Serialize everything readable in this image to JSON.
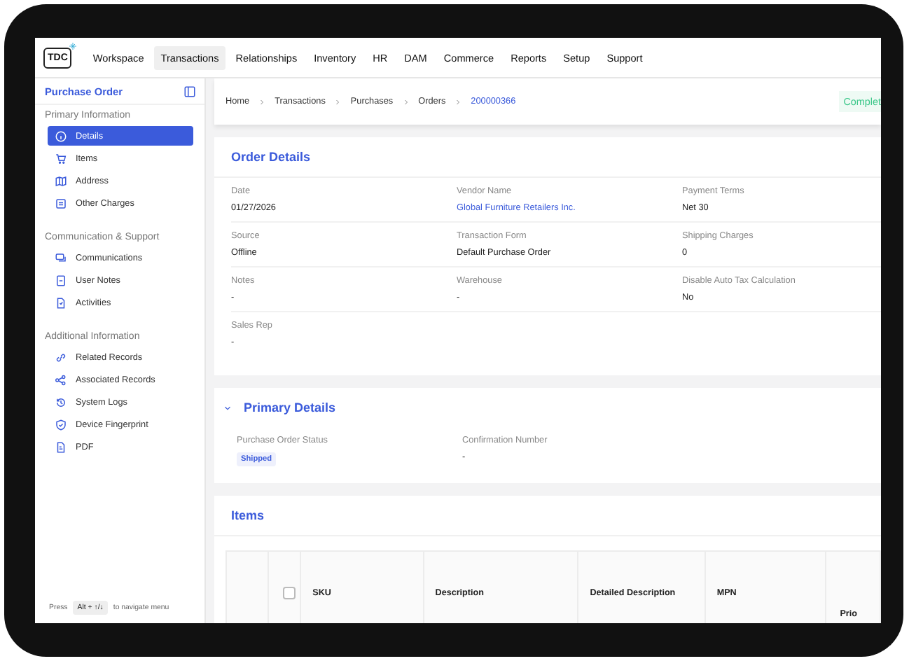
{
  "nav": {
    "logo": "TDC",
    "items": [
      {
        "label": "Workspace",
        "selected": false
      },
      {
        "label": "Transactions",
        "selected": true
      },
      {
        "label": "Relationships",
        "selected": false
      },
      {
        "label": "Inventory",
        "selected": false
      },
      {
        "label": "HR",
        "selected": false
      },
      {
        "label": "DAM",
        "selected": false
      },
      {
        "label": "Commerce",
        "selected": false
      },
      {
        "label": "Reports",
        "selected": false
      },
      {
        "label": "Setup",
        "selected": false
      },
      {
        "label": "Support",
        "selected": false
      }
    ]
  },
  "sidebar": {
    "title": "Purchase Order",
    "sections": [
      {
        "heading": "Primary Information",
        "items": [
          {
            "label": "Details",
            "selected": true
          },
          {
            "label": "Items",
            "selected": false
          },
          {
            "label": "Address",
            "selected": false
          },
          {
            "label": "Other Charges",
            "selected": false
          }
        ]
      },
      {
        "heading": "Communication & Support",
        "items": [
          {
            "label": "Communications",
            "selected": false
          },
          {
            "label": "User Notes",
            "selected": false
          },
          {
            "label": "Activities",
            "selected": false
          }
        ]
      },
      {
        "heading": "Additional Information",
        "items": [
          {
            "label": "Related Records",
            "selected": false
          },
          {
            "label": "Associated Records",
            "selected": false
          },
          {
            "label": "System Logs",
            "selected": false
          },
          {
            "label": "Device Fingerprint",
            "selected": false
          },
          {
            "label": "PDF",
            "selected": false
          }
        ]
      }
    ],
    "hint": {
      "prefix": "Press",
      "key": "Alt + ↑/↓",
      "suffix": "to navigate menu"
    }
  },
  "breadcrumb": {
    "items": [
      "Home",
      "Transactions",
      "Purchases",
      "Orders"
    ],
    "current": "200000366",
    "status": "Complet"
  },
  "order_details": {
    "title": "Order Details",
    "fields": [
      {
        "label": "Date",
        "value": "01/27/2026",
        "kind": "text"
      },
      {
        "label": "Vendor Name",
        "value": "Global Furniture Retailers Inc.",
        "kind": "link"
      },
      {
        "label": "Payment Terms",
        "value": "Net 30",
        "kind": "text"
      },
      {
        "label": "Source",
        "value": "Offline",
        "kind": "text"
      },
      {
        "label": "Transaction Form",
        "value": "Default Purchase Order",
        "kind": "text"
      },
      {
        "label": "Shipping Charges",
        "value": "0",
        "kind": "text"
      },
      {
        "label": "Notes",
        "value": "-",
        "kind": "text"
      },
      {
        "label": "Warehouse",
        "value": "-",
        "kind": "text"
      },
      {
        "label": "Disable Auto Tax Calculation",
        "value": "No",
        "kind": "text"
      },
      {
        "label": "Sales Rep",
        "value": "-",
        "kind": "text"
      }
    ]
  },
  "primary_details": {
    "title": "Primary Details",
    "expanded": true,
    "fields": [
      {
        "label": "Purchase Order Status",
        "value": "Shipped",
        "kind": "badge"
      },
      {
        "label": "Confirmation Number",
        "value": "-",
        "kind": "text"
      }
    ]
  },
  "items": {
    "title": "Items",
    "select_all_checked": false,
    "columns": [
      "SKU",
      "Description",
      "Detailed Description",
      "MPN"
    ],
    "column_7": "Prio"
  }
}
